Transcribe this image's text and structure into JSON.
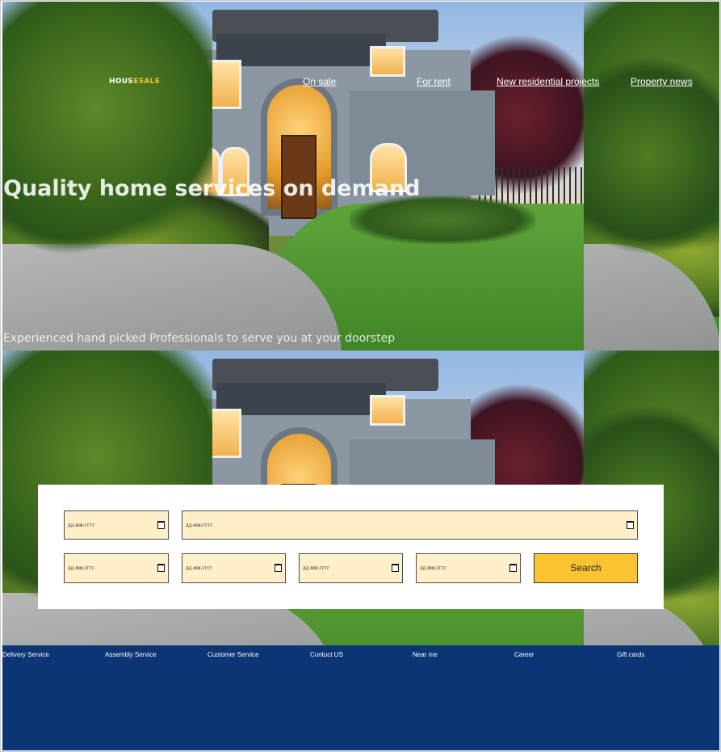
{
  "brand": {
    "logo_part1": "HOUS",
    "logo_part2": "ESALE"
  },
  "nav": {
    "items": [
      {
        "label": "On sale"
      },
      {
        "label": "For rent"
      },
      {
        "label": "New residential projects"
      },
      {
        "label": "Property news"
      }
    ]
  },
  "hero": {
    "headline": "Quality home services on demand",
    "subheadline": "Experienced hand picked Professionals to serve you at your doorstep"
  },
  "search": {
    "date_placeholder_1": "дд-мм-гггг",
    "date_placeholder_2": "дд-мм-гггг",
    "date_placeholder_3": "дд.мм.гггг",
    "date_placeholder_4": "дд.мм.гггг",
    "date_placeholder_5": "дд.мм.гггг",
    "date_placeholder_6": "дд.мм.гггг",
    "button_label": "Search"
  },
  "footer": {
    "links": [
      {
        "label": "Delivery Service"
      },
      {
        "label": "Assembly Service"
      },
      {
        "label": "Customer Service"
      },
      {
        "label": "Contuct US"
      },
      {
        "label": "Near me"
      },
      {
        "label": "Career"
      },
      {
        "label": "Gift cards"
      }
    ]
  },
  "colors": {
    "accent": "#fbc232",
    "field_background": "#fff0c9",
    "footer_background": "#0c3576"
  }
}
